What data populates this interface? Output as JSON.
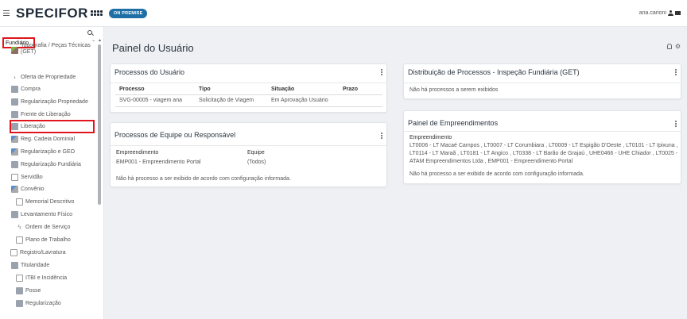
{
  "header": {
    "logo": "SPECIFOR",
    "badge": "ON PREMISE",
    "user": "ana.carioni"
  },
  "sidebar": {
    "module": "Fundiário",
    "items": [
      {
        "label": "Topografia / Peças Técnicas (GET)",
        "icon": "topography-icon"
      },
      {
        "label": "Oferta de Propriedade",
        "icon": "pin-icon"
      },
      {
        "label": "Compra",
        "icon": "house-icon"
      },
      {
        "label": "Regularização Propriedade",
        "icon": "house-icon"
      },
      {
        "label": "Frente de Liberação",
        "icon": "truck-icon"
      },
      {
        "label": "Liberação",
        "icon": "truck-icon"
      },
      {
        "label": "Reg. Cadeia Dominial",
        "icon": "document-icon"
      },
      {
        "label": "Regularização e GEO",
        "icon": "document-icon"
      },
      {
        "label": "Regularização Fundiária",
        "icon": "buildings-icon"
      },
      {
        "label": "Servidão",
        "icon": "grid-icon"
      },
      {
        "label": "Convênio",
        "icon": "document-icon"
      },
      {
        "label": "Memorial Descritivo",
        "icon": "page-icon"
      },
      {
        "label": "Levantamento Físico",
        "icon": "buildings-icon"
      },
      {
        "label": "Ordem de Serviço",
        "icon": "bolt-icon"
      },
      {
        "label": "Plano de Trabalho",
        "icon": "page-icon"
      },
      {
        "label": "Registro/Lavratura",
        "icon": "book-icon"
      },
      {
        "label": "Titularidade",
        "icon": "buildings-icon"
      },
      {
        "label": "ITBI e Incidência",
        "icon": "page-icon"
      },
      {
        "label": "Posse",
        "icon": "house-icon"
      },
      {
        "label": "Regularização",
        "icon": "buildings-icon"
      }
    ]
  },
  "main": {
    "title": "Painel do Usuário",
    "processos_usuario": {
      "title": "Processos do Usuário",
      "columns": [
        "Processo",
        "Tipo",
        "Situação",
        "Prazo"
      ],
      "rows": [
        [
          "SVG-00005 - viagem ana",
          "Solicitação de Viagem",
          "Em Aprovação Usuário",
          ""
        ]
      ]
    },
    "processos_equipe": {
      "title": "Processos de Equipe ou Responsável",
      "col1": "Empreendimento",
      "col2": "Equipe",
      "val1": "EMP001 - Empreendimento Portal",
      "val2": "(Todos)",
      "empty": "Não há processo a ser exibido de acordo com configuração informada."
    },
    "distribuicao": {
      "title": "Distribuição de Processos - Inspeção Fundiária (GET)",
      "empty": "Não há processos a serem exibidos"
    },
    "empreendimentos": {
      "title": "Painel de Empreendimentos",
      "label": "Empreendimento",
      "list": "LT0006 - LT Macaé Campos , LT0007 - LT Corumbiara , LT0009 - LT Espigão D'Oeste , LT0101 - LT Ipixuna , LT0114 - LT Maraã , LT0181 - LT Angico , LT0338 - LT Barão de Grajaú , UHE0466 - UHE Chiador , LT0025 - ATAM Empreendimentos Ltda , EMP001 - Empreendimento Portal",
      "empty": "Não há processo a ser exibido de acordo com configuração informada."
    }
  }
}
